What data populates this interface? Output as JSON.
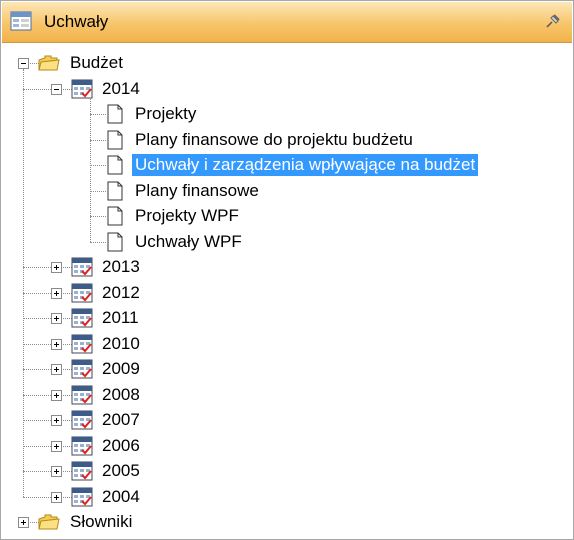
{
  "panel": {
    "title": "Uchwały",
    "title_icon": "grid-window-icon",
    "pin_icon": "pin-icon"
  },
  "tree": {
    "root": {
      "label": "Budżet",
      "expanded": true,
      "year_expanded": {
        "label": "2014",
        "items": [
          "Projekty",
          "Plany finansowe do projektu budżetu",
          "Uchwały i zarządzenia wpływające na budżet",
          "Plany finansowe",
          "Projekty WPF",
          "Uchwały WPF"
        ],
        "selected_item": "Uchwały i zarządzenia wpływające na budżet"
      },
      "years_collapsed": [
        "2013",
        "2012",
        "2011",
        "2010",
        "2009",
        "2008",
        "2007",
        "2006",
        "2005",
        "2004"
      ]
    },
    "slowniki": {
      "label": "Słowniki",
      "expanded": false
    }
  },
  "colors": {
    "selection": "#3399ff",
    "title_gradient_top": "#fde7b8",
    "title_gradient_bottom": "#f2b24a"
  }
}
